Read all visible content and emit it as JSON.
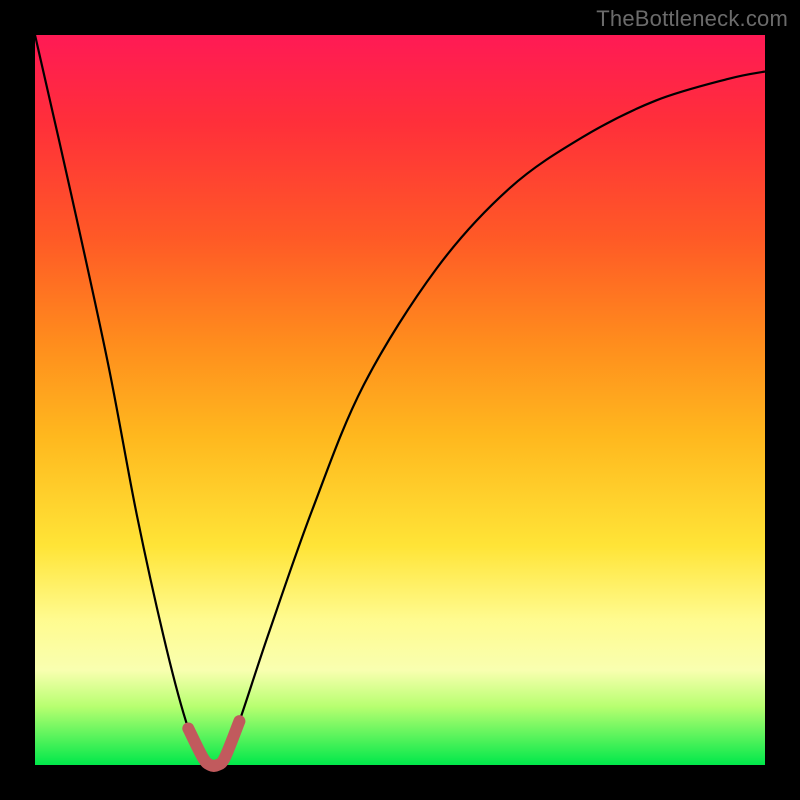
{
  "watermark": "TheBottleneck.com",
  "chart_data": {
    "type": "line",
    "title": "",
    "xlabel": "",
    "ylabel": "",
    "xlim": [
      0,
      100
    ],
    "ylim": [
      0,
      100
    ],
    "series": [
      {
        "name": "bottleneck-curve",
        "x": [
          0,
          5,
          10,
          14,
          18,
          21,
          23,
          24,
          25,
          26,
          28,
          32,
          38,
          45,
          55,
          65,
          75,
          85,
          95,
          100
        ],
        "values": [
          100,
          78,
          55,
          34,
          16,
          5,
          1,
          0,
          0,
          1,
          6,
          18,
          35,
          52,
          68,
          79,
          86,
          91,
          94,
          95
        ]
      }
    ],
    "highlight": {
      "name": "optimal-region",
      "x_range": [
        22,
        27
      ],
      "color": "#c15a5d"
    },
    "gradient_stops": [
      {
        "pos": 0.0,
        "color": "#ff1a55"
      },
      {
        "pos": 0.12,
        "color": "#ff2f3a"
      },
      {
        "pos": 0.28,
        "color": "#ff5a26"
      },
      {
        "pos": 0.42,
        "color": "#ff8c1d"
      },
      {
        "pos": 0.55,
        "color": "#ffb81e"
      },
      {
        "pos": 0.7,
        "color": "#ffe437"
      },
      {
        "pos": 0.8,
        "color": "#fffb8f"
      },
      {
        "pos": 0.87,
        "color": "#f9ffb0"
      },
      {
        "pos": 0.92,
        "color": "#b7ff70"
      },
      {
        "pos": 1.0,
        "color": "#00e84a"
      }
    ]
  }
}
